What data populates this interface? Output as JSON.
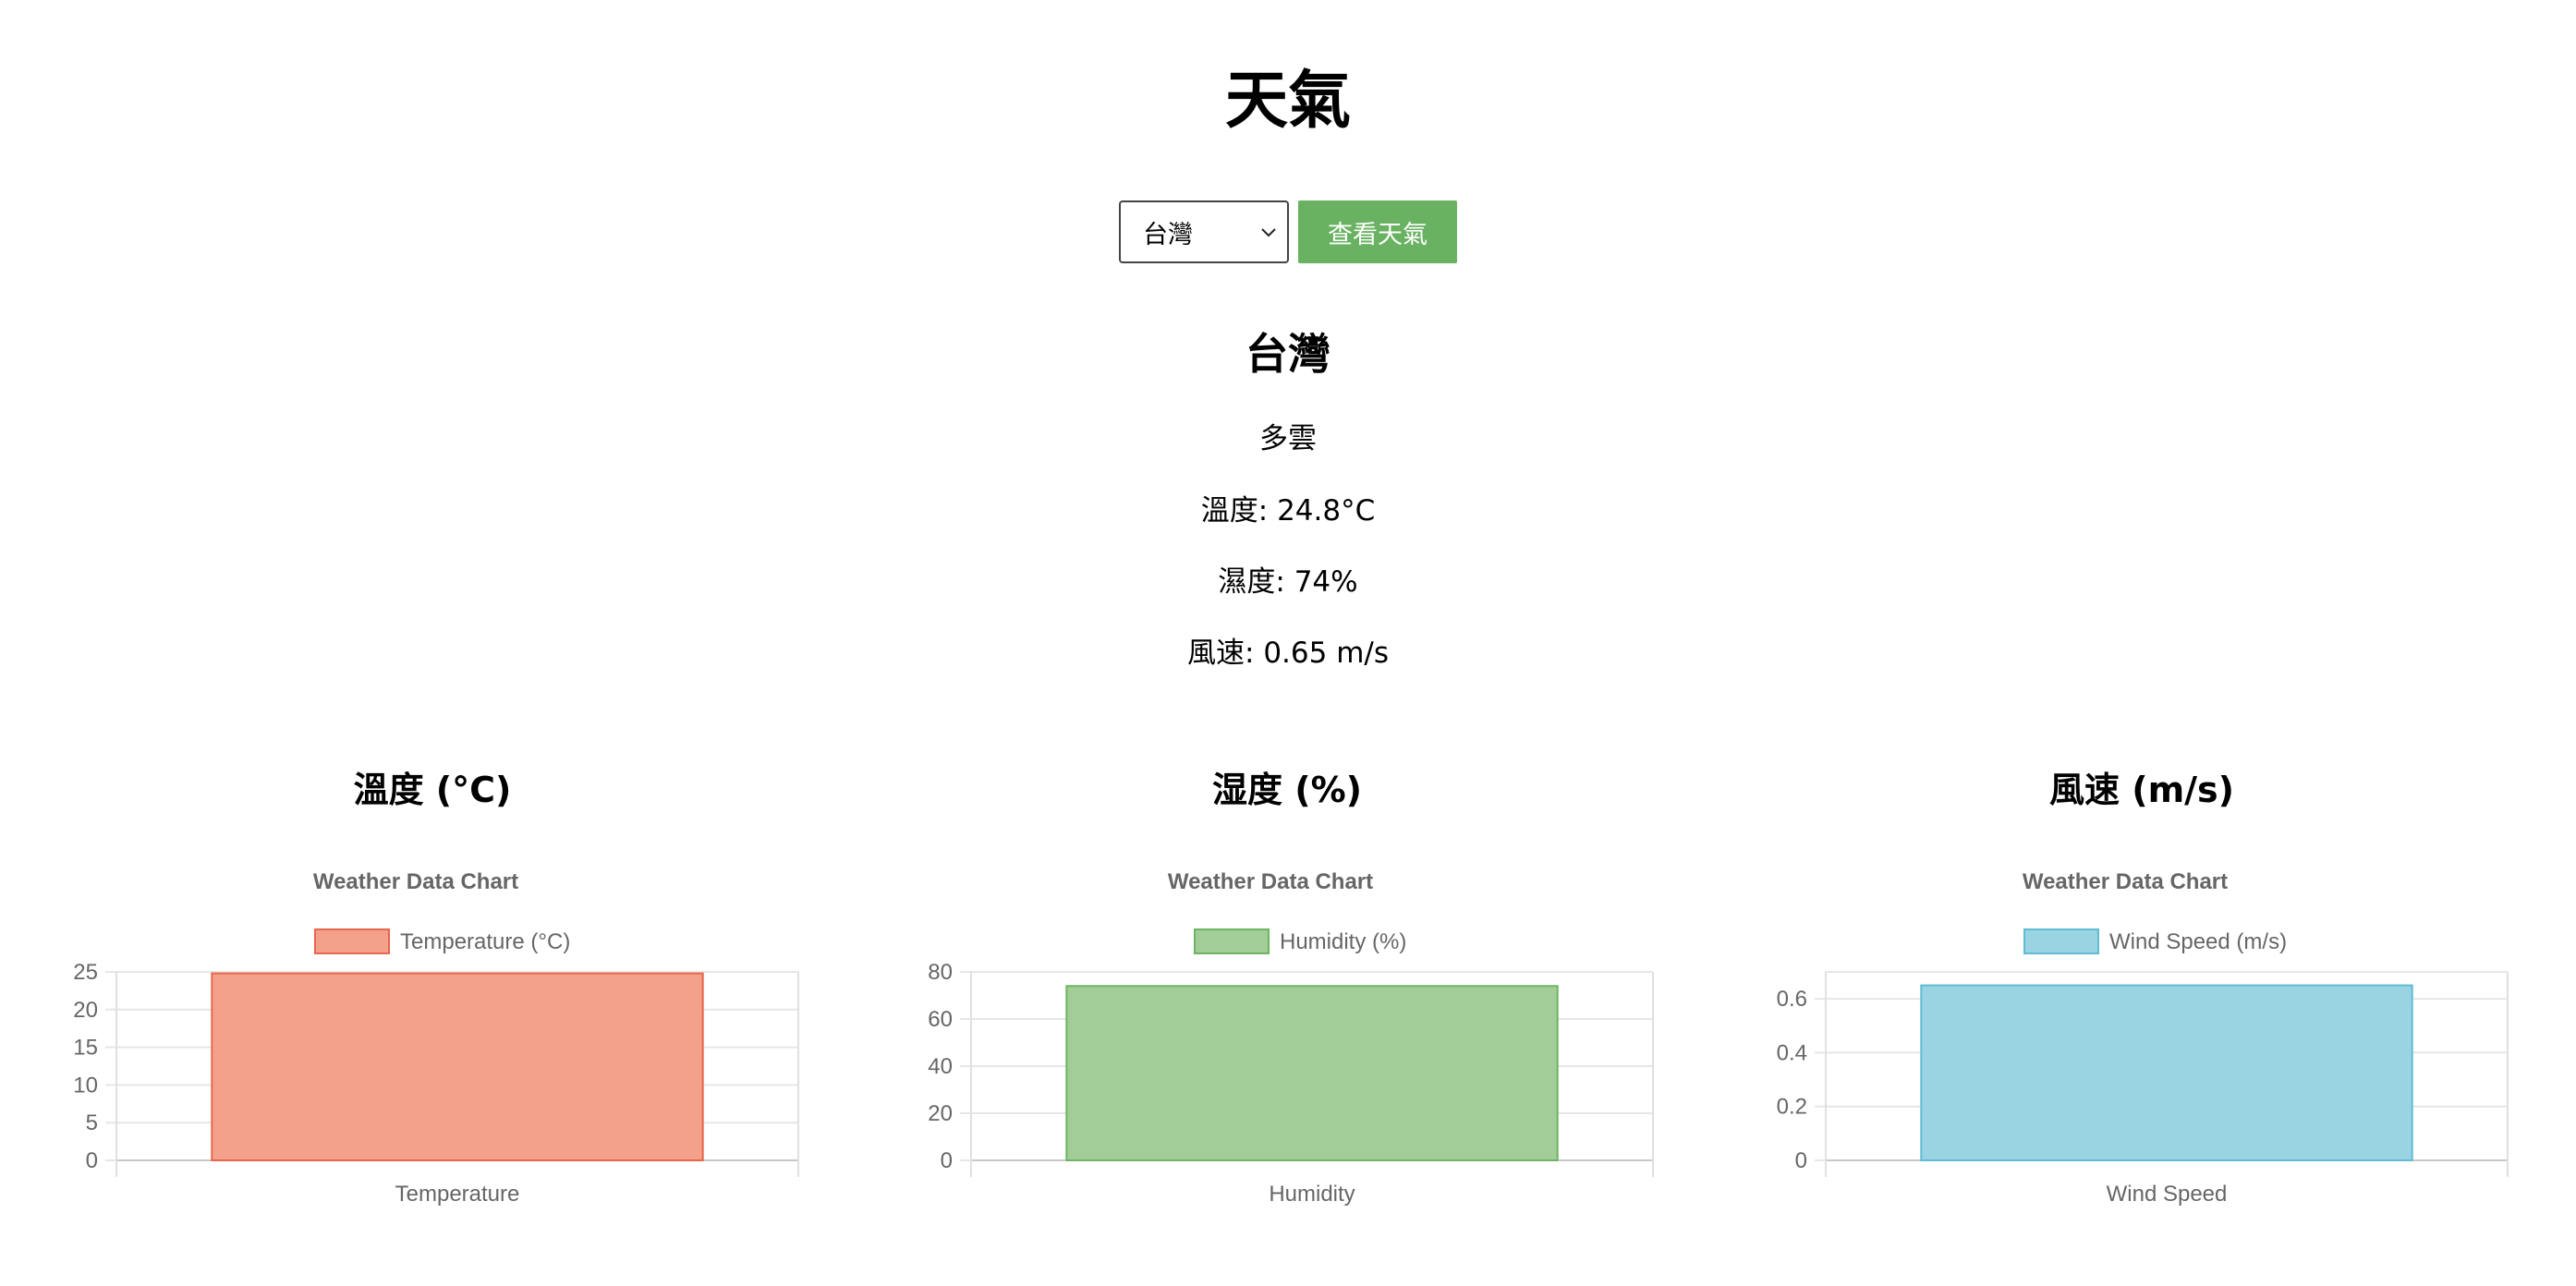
{
  "page": {
    "title": "天氣"
  },
  "controls": {
    "selected_city": "台灣",
    "button_label": "查看天氣"
  },
  "weather": {
    "city": "台灣",
    "condition": "多雲",
    "temperature_line": "溫度: 24.8°C",
    "humidity_line": "濕度: 74%",
    "wind_line": "風速: 0.65 m/s"
  },
  "charts": {
    "temp_heading": "溫度 (°C)",
    "humidity_heading": "湿度 (%)",
    "wind_heading": "風速 (m/s)"
  },
  "chart_data": [
    {
      "type": "bar",
      "title": "Weather Data Chart",
      "categories": [
        "Temperature"
      ],
      "series": [
        {
          "name": "Temperature (°C)",
          "values": [
            24.8
          ]
        }
      ],
      "ylim": [
        0,
        25
      ],
      "yticks": [
        0,
        5,
        10,
        15,
        20,
        25
      ],
      "legend": "top",
      "grid": true,
      "color": "#f4a18b",
      "border_color": "#e8664f"
    },
    {
      "type": "bar",
      "title": "Weather Data Chart",
      "categories": [
        "Humidity"
      ],
      "series": [
        {
          "name": "Humidity (%)",
          "values": [
            74
          ]
        }
      ],
      "ylim": [
        0,
        80
      ],
      "yticks": [
        0,
        20,
        40,
        60,
        80
      ],
      "legend": "top",
      "grid": true,
      "color": "#a2cc98",
      "border_color": "#6db561"
    },
    {
      "type": "bar",
      "title": "Weather Data Chart",
      "categories": [
        "Wind Speed"
      ],
      "series": [
        {
          "name": "Wind Speed (m/s)",
          "values": [
            0.65
          ]
        }
      ],
      "ylim": [
        0,
        0.7
      ],
      "yticks": [
        0,
        0.2,
        0.4,
        0.6
      ],
      "legend": "top",
      "grid": true,
      "color": "#9ad4e2",
      "border_color": "#5fbcd3"
    }
  ]
}
